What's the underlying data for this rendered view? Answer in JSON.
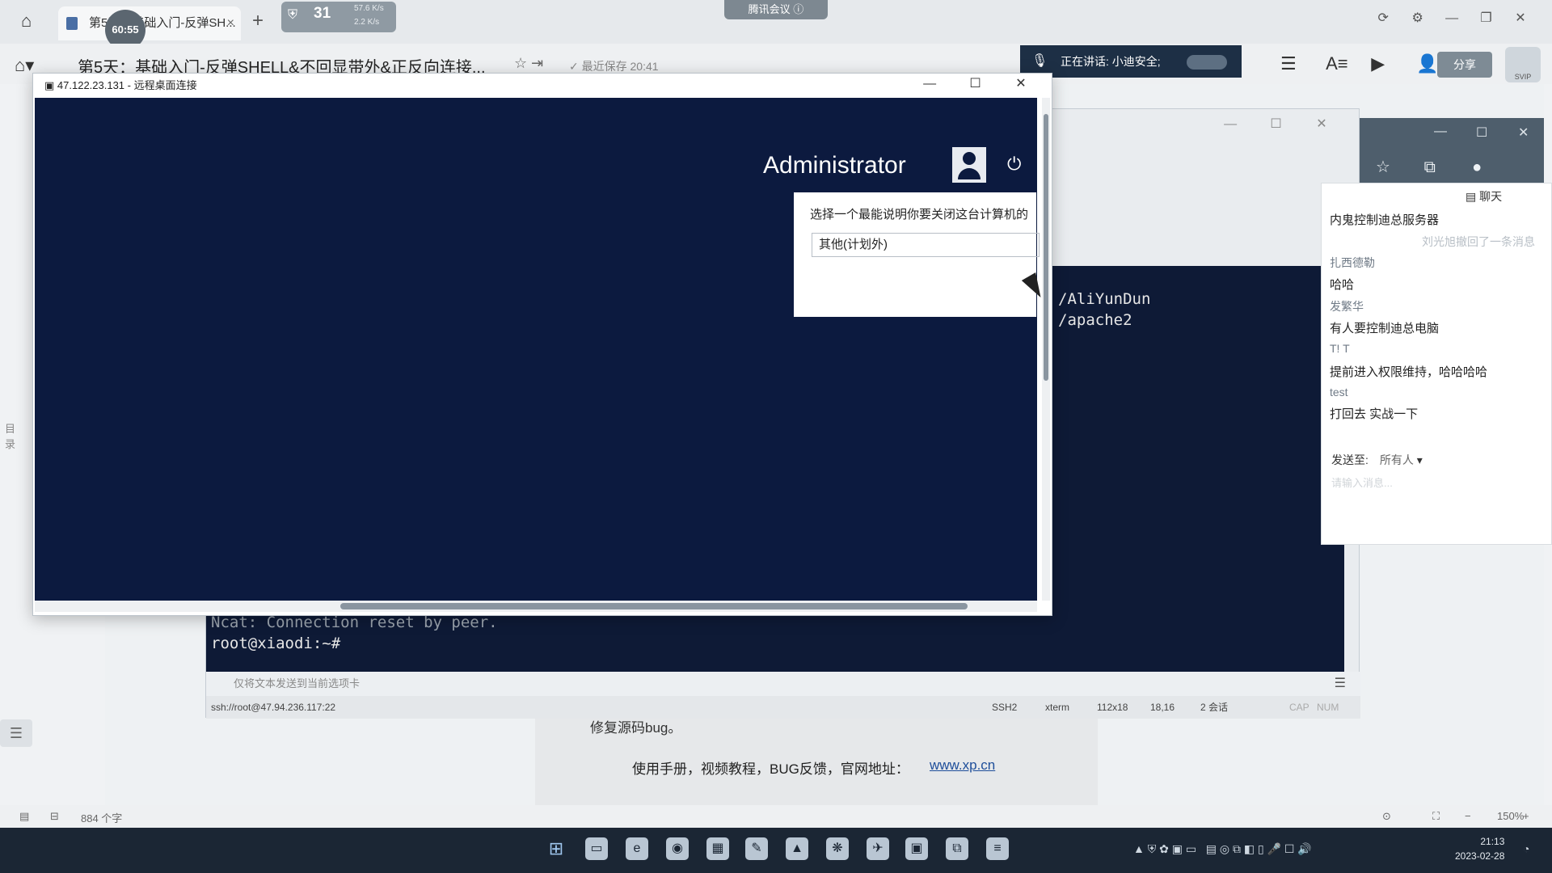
{
  "browser": {
    "tab_label": "第5天：基础入门-反弹SH...",
    "timer": "60:55",
    "net_count": "31",
    "net_up": "57.6 K/s",
    "net_down": "2.2 K/s",
    "meeting_label": "腾讯会议",
    "doc_title": "第5天：基础入门-反弹SHELL&不回显带外&正反向连接...",
    "saved_status": "最近保存 20:41",
    "speaking": "正在讲话: 小迪安全;",
    "share_label": "分享",
    "avatar_badge": "SVIP"
  },
  "rdp": {
    "title": "47.122.23.131 - 远程桌面连接",
    "user": "Administrator",
    "dialog_prompt": "选择一个最能说明你要关闭这台计算机的",
    "dialog_selected": "其他(计划外)"
  },
  "terminal": {
    "line_aliyun": "/AliYunDun",
    "line_apache": "/apache2",
    "line_ncat": "Ncat: Connection reset by peer.",
    "prompt": "root@xiaodi:~#",
    "input_placeholder": "仅将文本发送到当前选项卡",
    "status": {
      "session": "ssh://root@47.94.236.117:22",
      "protocol": "SSH2",
      "term": "xterm",
      "size": "112x18",
      "pos": "18,16",
      "sessions": "2 会话",
      "caps": "CAP",
      "num": "NUM"
    }
  },
  "chat": {
    "title": "聊天",
    "messages": [
      {
        "text": "内鬼控制迪总服务器"
      },
      {
        "system": "刘光旭撤回了一条消息"
      },
      {
        "name": "扎西德勒"
      },
      {
        "text": "哈哈"
      },
      {
        "name": "发繁华"
      },
      {
        "text": "有人要控制迪总电脑"
      },
      {
        "name": "T! T"
      },
      {
        "text": "提前进入权限维持，哈哈哈哈"
      },
      {
        "name": "test"
      },
      {
        "text": "打回去 实战一下"
      }
    ],
    "send_to_label": "发送至:",
    "send_to_value": "所有人",
    "input_placeholder": "请输入消息..."
  },
  "document": {
    "line1": "修复源码bug。",
    "line2": "使用手册，视频教程，BUG反馈，官网地址：",
    "link": "www.xp.cn"
  },
  "statusbar": {
    "word_count": "884 个字",
    "zoom": "150%"
  },
  "taskbar": {
    "time": "21:13",
    "date": "2023-02-28"
  }
}
